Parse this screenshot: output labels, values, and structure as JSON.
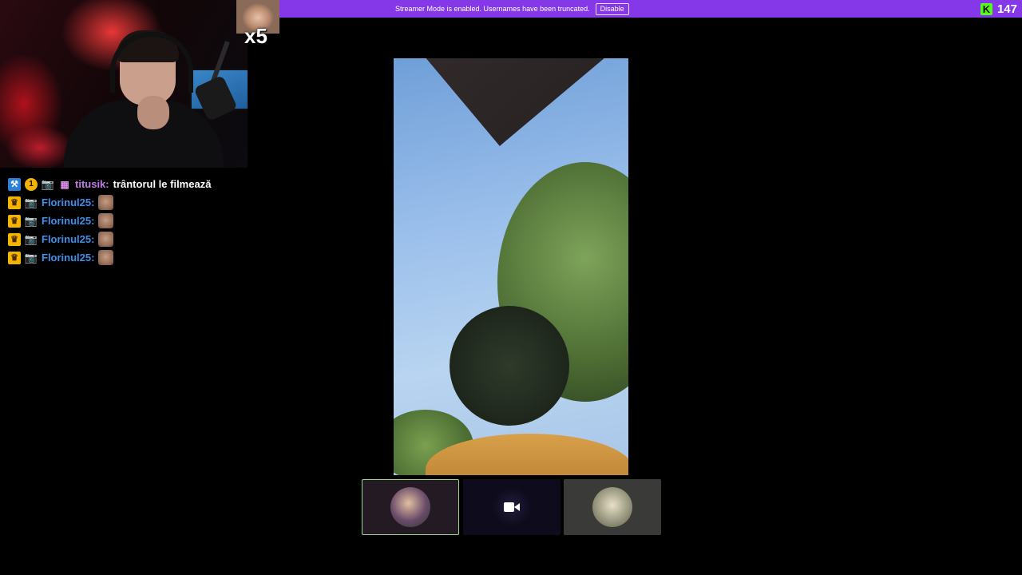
{
  "banner": {
    "text": "Streamer Mode is enabled. Usernames have been truncated.",
    "disable_label": "Disable"
  },
  "viewers": {
    "count": "147",
    "logo_letter": "K"
  },
  "alert": {
    "multiplier": "x5"
  },
  "chat": [
    {
      "badges": [
        "pickaxe-badge",
        "sub-badge-1",
        "camera-badge",
        "gift-badge"
      ],
      "badge_sub": "1",
      "username": "titusik:",
      "message": "trântorul le filmează"
    },
    {
      "badges": [
        "crown-badge",
        "camera-badge"
      ],
      "username": "Florinul25:",
      "emote": "emote"
    },
    {
      "badges": [
        "crown-badge",
        "camera-badge"
      ],
      "username": "Florinul25:",
      "emote": "emote"
    },
    {
      "badges": [
        "crown-badge",
        "camera-badge"
      ],
      "username": "Florinul25:",
      "emote": "emote"
    },
    {
      "badges": [
        "crown-badge",
        "camera-badge"
      ],
      "username": "Florinul25:",
      "emote": "emote"
    }
  ],
  "call": {
    "participants": [
      {
        "type": "avatar",
        "selected": true
      },
      {
        "type": "camera-icon",
        "selected": false
      },
      {
        "type": "avatar",
        "selected": false
      }
    ]
  },
  "colors": {
    "banner_bg": "#8438e8",
    "kick_green": "#53fc18",
    "username_purple": "#c27ce8",
    "username_blue": "#3f8fe8",
    "selected_border": "#9bd68a"
  }
}
